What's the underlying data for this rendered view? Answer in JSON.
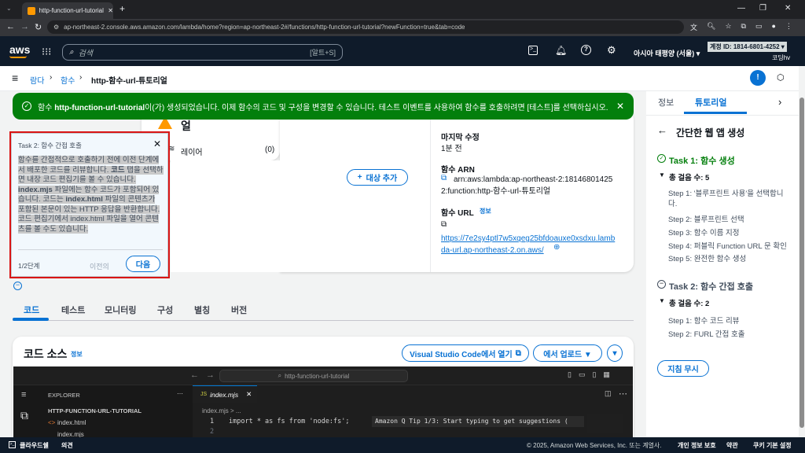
{
  "browser": {
    "tab_title": "http-function-url-tutorial | 함",
    "url": "ap-northeast-2.console.aws.amazon.com/lambda/home?region=ap-northeast-2#/functions/http-function-url-tutorial?newFunction=true&tab=code"
  },
  "aws": {
    "logo": "aws",
    "search_placeholder": "검색",
    "search_shortcut": "[알트+S]",
    "region": "아시아 태평양 (서울) ▾",
    "account": "계정 ID: 1814-6801-4252 ▾",
    "user": "코딩hv"
  },
  "breadcrumb": {
    "item1": "람다",
    "item2": "함수",
    "current": "http-함수-url-튜토리얼"
  },
  "banner": {
    "prefix": "함수 ",
    "name": "http-function-url-tutorial",
    "suffix": "이(가) 생성되었습니다. 이제 함수의 코드 및 구성을 변경할 수 있습니다. 테스트 이벤트를 사용하여 함수를 호출하려면 [테스트]를 선택하십시오."
  },
  "overview": {
    "layer_label": "레이어",
    "layer_count": "(0)",
    "fragment": "얼",
    "add_dest": "대상 추가",
    "last_modified_label": "마지막 수정",
    "last_modified": "1분 전",
    "arn_label": "함수 ARN",
    "arn": "arn:aws:lambda:ap-northeast-2:181468014252:function:http-함수-url-튜토리얼",
    "url_label": "함수 URL",
    "info": "정보",
    "function_url": "https://7e2sy4ptl7w5xqeg25bfdoauxe0xsdxu.lambda-url.ap-northeast-2.on.aws/"
  },
  "popover": {
    "title": "Task 2: 함수 간접 호출",
    "body_parts": [
      "함수를 간접적으로 호출하기 전에 이전 단계에서 배포한 코드를 리뷰합니다. ",
      "코드",
      " 탭을 선택하면 내장 코드 편집기를 볼 수 있습니다. ",
      "index.mjs",
      " 파일에는 함수 코드가 포함되어 있습니다. 코드는 ",
      "index.html",
      " 파일의 콘텐츠가 포함된 본문이 있는 HTTP 응답을 반환합니다. 코드 편집기에서 index.html 파일을 열어 콘텐츠를 볼 수도 있습니다."
    ],
    "step": "1/2단계",
    "prev": "이전의",
    "next": "다음"
  },
  "tabs": [
    "코드",
    "테스트",
    "모니터링",
    "구성",
    "별칭",
    "버전"
  ],
  "code_source": {
    "title": "코드 소스",
    "info": "정보",
    "vscode_btn": "Visual Studio Code에서 열기",
    "upload_btn": "에서 업로드 ▼",
    "editor_search": "http-function-url-tutorial",
    "explorer_label": "EXPLORER",
    "folder": "HTTP-FUNCTION-URL-TUTORIAL",
    "files": [
      "index.html",
      "index.mjs"
    ],
    "tab_file": "index.mjs",
    "breadcrumb": "index.mjs > ...",
    "line1": "import * as fs from 'node:fs';",
    "tip": "Amazon Q Tip 1/3: Start typing to get suggestions (",
    "line_numbers": [
      "1",
      "2"
    ]
  },
  "right": {
    "tab_info": "정보",
    "tab_tutorial": "튜토리얼",
    "heading": "간단한 웹 앱 생성",
    "task1": "Task 1: 함수 생성",
    "task1_total": "총 걸음 수: 5",
    "task1_steps": [
      "Step 1: '블루프린트 사용'을 선택합니다.",
      "Step 2: 블루프린트 선택",
      "Step 3: 함수 이름 지정",
      "Step 4: 퍼블릭 Function URL 문 확인",
      "Step 5: 완전한 함수 생성"
    ],
    "task2": "Task 2: 함수 간접 호출",
    "task2_total": "총 걸음 수: 2",
    "task2_steps": [
      "Step 1: 함수 코드 리뷰",
      "Step 2: FURL 간접 호출"
    ],
    "dismiss": "지침 무시"
  },
  "footer": {
    "cloudshell": "클라우드쉘",
    "feedback": "의견",
    "copyright": "© 2025, Amazon Web Services, Inc. 또는 계열사.",
    "privacy": "개인 정보 보호",
    "terms": "약관",
    "cookies": "쿠키 기본 설정"
  },
  "colors": {
    "accent": "#0972d3",
    "success": "#037f0c",
    "nav": "#0f1b2a",
    "highlight_border": "#d91515"
  }
}
